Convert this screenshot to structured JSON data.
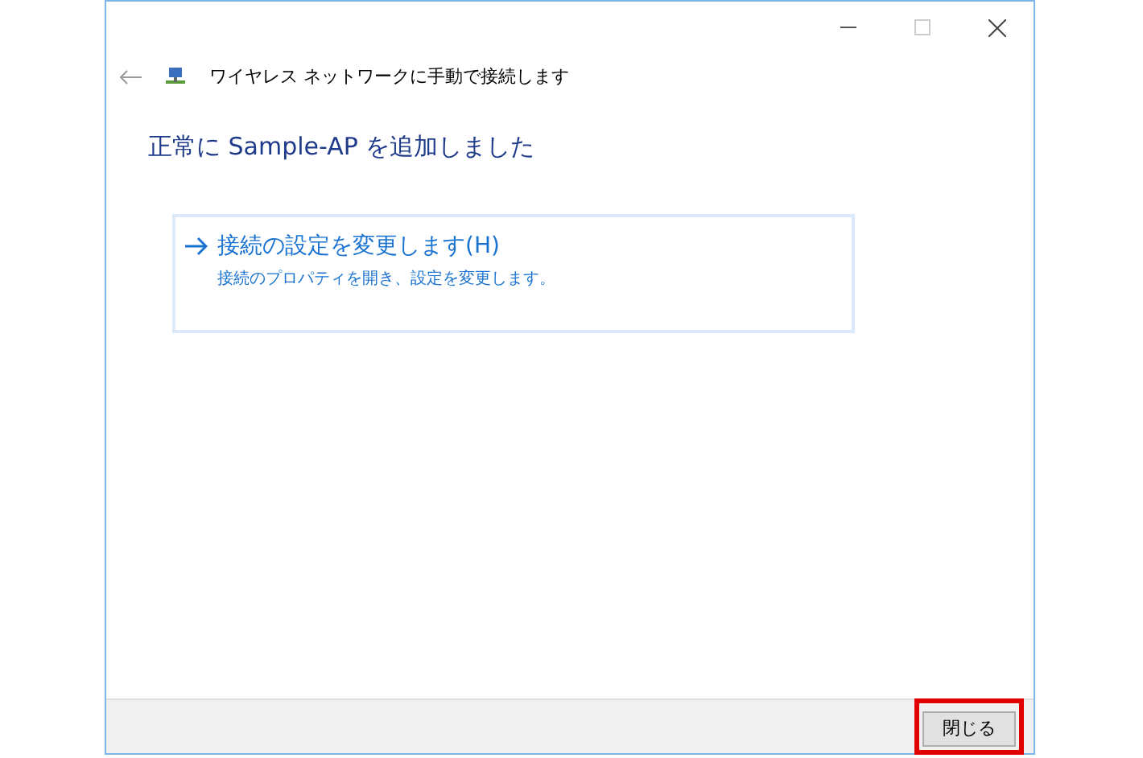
{
  "window": {
    "title": "ワイヤレス ネットワークに手動で接続します"
  },
  "heading": "正常に Sample-AP を追加しました",
  "options": [
    {
      "title": "接続の設定を変更します(H)",
      "description": "接続のプロパティを開き、設定を変更します。"
    }
  ],
  "footer": {
    "buttons": [
      {
        "label": "閉じる",
        "highlighted": true
      }
    ]
  }
}
